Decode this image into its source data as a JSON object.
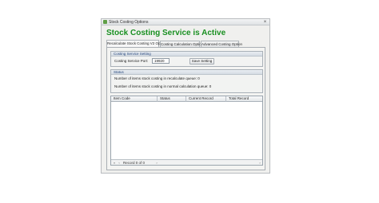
{
  "window": {
    "title": "Stock Costing Options",
    "close_glyph": "×"
  },
  "heading": "Stock Costing Service is Active",
  "tabs": [
    {
      "label": "Recalculate Stock Costing V2 Option",
      "active": true
    },
    {
      "label": "Costing Calculation Option",
      "active": false
    },
    {
      "label": "Advanced Costing Option",
      "active": false
    }
  ],
  "port_setting": {
    "section_title": "Costing Service Setting",
    "port_label": "Costing Service Port:",
    "port_value": "19920",
    "save_label": "Save Setting"
  },
  "status": {
    "section_title": "Status",
    "recalculate_queue": "Number of items stock costing in recalculate queue: 0",
    "normal_queue": "Number of items stock costing in normal calculation queue: 0"
  },
  "grid": {
    "columns": [
      "Item Code",
      "Status",
      "Current Record",
      "Total Record"
    ],
    "rows": [],
    "record_text": "Record 0 of 0",
    "nav_first": "«",
    "nav_prev": "‹",
    "nav_next": "›",
    "scroll_right": "›"
  },
  "icons": {
    "app_icon": "app-icon",
    "close_icon": "close-icon"
  },
  "colors": {
    "heading": "#199021",
    "section_title": "#28487d"
  }
}
